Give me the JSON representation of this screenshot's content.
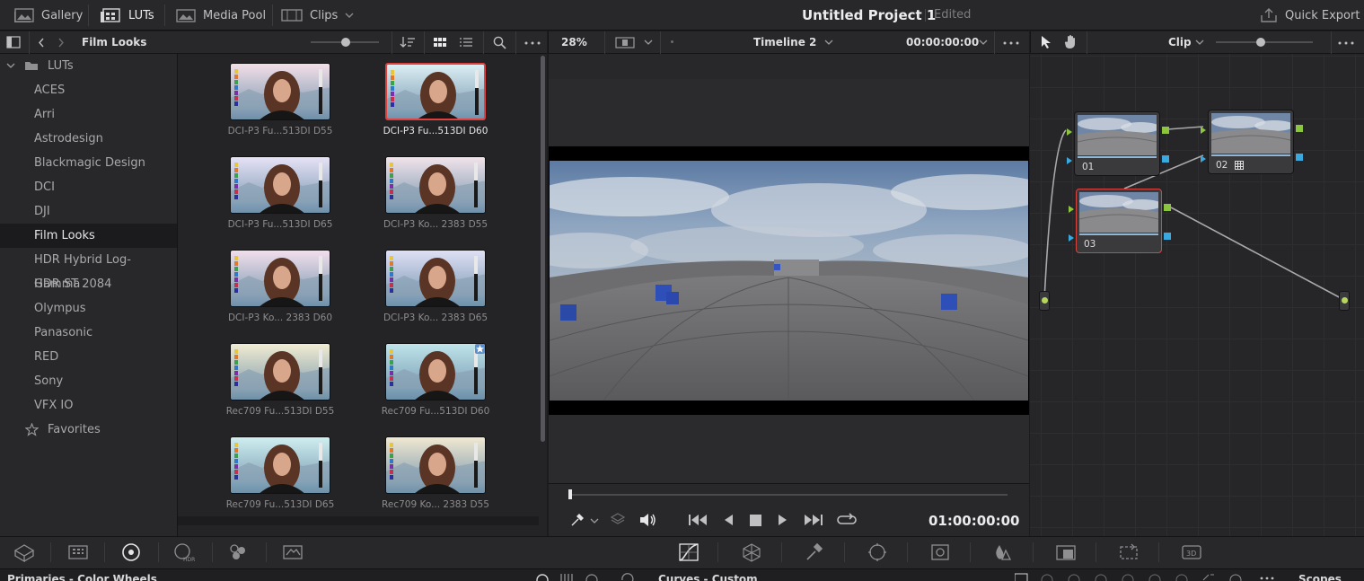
{
  "topbar": {
    "gallery": "Gallery",
    "luts": "LUTs",
    "media_pool": "Media Pool",
    "clips": "Clips",
    "project_title": "Untitled Project 1",
    "project_status": "Edited",
    "quick_export": "Quick Export"
  },
  "lut_panel": {
    "title": "Film Looks",
    "tree_root": "LUTs",
    "tree_items": [
      "ACES",
      "Arri",
      "Astrodesign",
      "Blackmagic Design",
      "DCI",
      "DJI",
      "Film Looks",
      "HDR Hybrid Log-Gamma",
      "HDR ST 2084",
      "Olympus",
      "Panasonic",
      "RED",
      "Sony",
      "VFX IO"
    ],
    "favorites": "Favorites",
    "selected_folder": "Film Looks",
    "luts": [
      {
        "label": "DCI-P3 Fu...513DI D55",
        "tint": "#f2dfe8"
      },
      {
        "label": "DCI-P3 Fu...513DI D60",
        "tint": "#dbeef3"
      },
      {
        "label": "DCI-P3 Fu...513DI D65",
        "tint": "#e6e2f6"
      },
      {
        "label": "DCI-P3 Ko... 2383 D55",
        "tint": "#f1e3ea"
      },
      {
        "label": "DCI-P3 Ko... 2383 D60",
        "tint": "#f1dfec"
      },
      {
        "label": "DCI-P3 Ko... 2383 D65",
        "tint": "#dfe0f5"
      },
      {
        "label": "Rec709 Fu...513DI D55",
        "tint": "#f1ecd2"
      },
      {
        "label": "Rec709 Fu...513DI D60",
        "tint": "#bfe4ea"
      },
      {
        "label": "Rec709 Fu...513DI D65",
        "tint": "#cfeef0"
      },
      {
        "label": "Rec709 Ko... 2383 D55",
        "tint": "#f0e8d2"
      }
    ]
  },
  "viewer": {
    "zoom": "28%",
    "timeline": "Timeline 2",
    "timecode_top": "00:00:00:00",
    "timecode": "01:00:00:00"
  },
  "node_editor": {
    "mode": "Clip",
    "nodes": [
      "01",
      "02",
      "03"
    ]
  },
  "bottom": {
    "left_panel": "Primaries - Color Wheels",
    "curves": "Curves - Custom",
    "scopes": "Scopes"
  },
  "colors": {
    "selection_red": "#e0413e",
    "node_green": "#8cc63f",
    "node_blue": "#3aa9e0"
  }
}
